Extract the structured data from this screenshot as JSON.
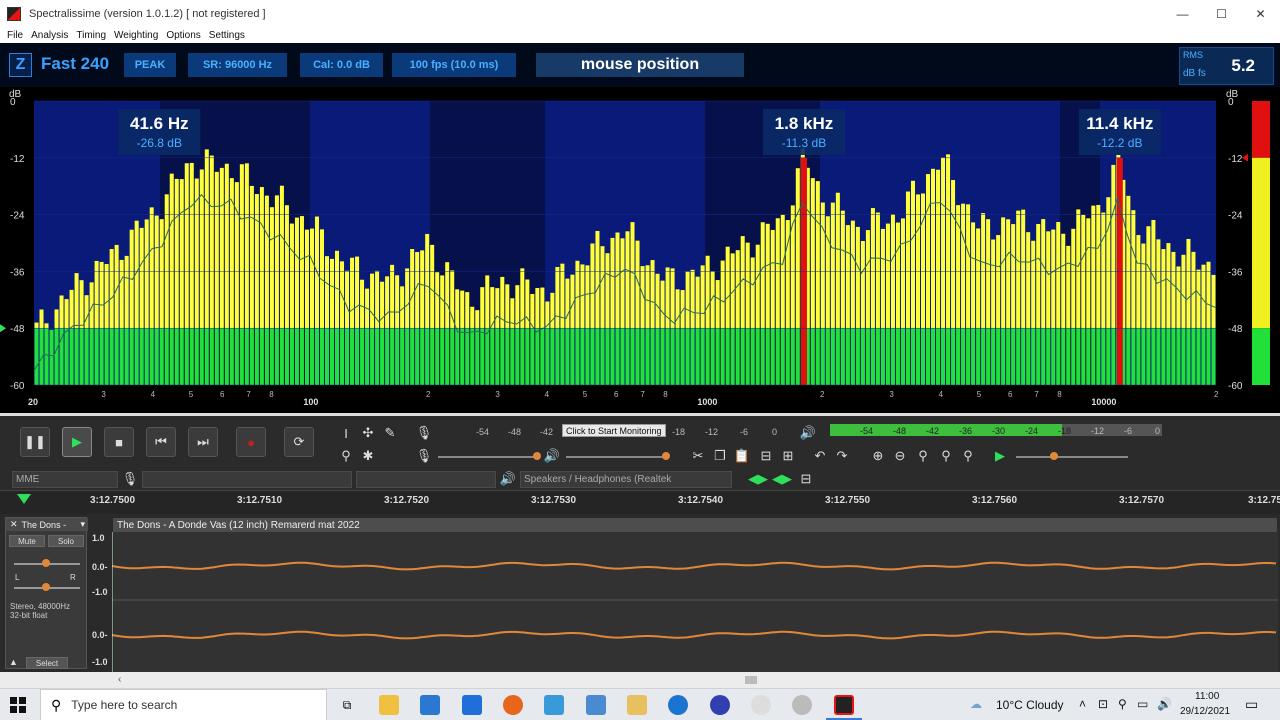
{
  "window": {
    "title": "Spectralissime (version 1.0.1.2) [ not registered ]",
    "controls": [
      "—",
      "☐",
      "✕"
    ]
  },
  "menu": [
    "File",
    "Analysis",
    "Timing",
    "Weighting",
    "Options",
    "Settings"
  ],
  "spectrum_header": {
    "z_label": "Z",
    "mode": "Fast 240",
    "peak": "PEAK",
    "sr": "SR: 96000 Hz",
    "cal": "Cal:  0.0 dB",
    "fps": "100 fps (10.0 ms)",
    "mouse_position": "mouse position",
    "rms_label": "RMS",
    "dbfs_label": "dB fs",
    "rms_value": "5.2"
  },
  "spectrum": {
    "db_unit": "dB",
    "db_ticks": [
      "0",
      "-12",
      "-24",
      "-36",
      "-48",
      "-60"
    ],
    "peaks": [
      {
        "freq": "41.6 Hz",
        "level": "-26.8 dB"
      },
      {
        "freq": "1.8 kHz",
        "level": "-11.3 dB"
      },
      {
        "freq": "11.4 kHz",
        "level": "-12.2 dB"
      }
    ],
    "freq_labels": [
      "20",
      "100",
      "1000",
      "10000"
    ],
    "minor_labels": [
      "3",
      "4",
      "5",
      "6",
      "7",
      "8",
      "2",
      "3",
      "4",
      "5",
      "6",
      "7",
      "8",
      "2",
      "3",
      "4",
      "5",
      "6",
      "7",
      "8",
      "2"
    ]
  },
  "chart_data": {
    "type": "bar",
    "title": "",
    "xlabel": "",
    "ylabel": "dB",
    "ylim": [
      -60,
      0
    ],
    "x_scale": "log",
    "xlim": [
      20,
      20000
    ],
    "x_ticks": [
      20,
      100,
      1000,
      10000
    ],
    "series": [
      {
        "name": "",
        "x": [
          20,
          25,
          31.5,
          40,
          50,
          63,
          80,
          100,
          125,
          160,
          200,
          250,
          315,
          400,
          500,
          630,
          800,
          1000,
          1250,
          1600,
          1800,
          2000,
          2500,
          3150,
          4000,
          5000,
          6300,
          8000,
          10000,
          11400,
          12500,
          16000,
          20000
        ],
        "values": [
          -49,
          -40,
          -33,
          -24,
          -13,
          -14,
          -20,
          -26,
          -35,
          -38,
          -30,
          -42,
          -38,
          -40,
          -33,
          -27,
          -38,
          -36,
          -31,
          -25,
          -12,
          -20,
          -27,
          -24,
          -12,
          -27,
          -25,
          -28,
          -23,
          -13,
          -26,
          -32,
          -35
        ]
      }
    ],
    "grid": false,
    "legend": "none"
  },
  "toolbar": {
    "pause": "❚❚",
    "play": "▶",
    "stop": "■",
    "skip_start": "⏮",
    "skip_end": "⏭",
    "record": "●",
    "loop": "⟳",
    "monitor": "Click to Start Monitoring",
    "rec_scale": [
      "-54",
      "-48",
      "-42",
      "-18",
      "-12",
      "-6",
      "0"
    ],
    "play_scale": [
      "-54",
      "-48",
      "-42",
      "-36",
      "-30",
      "-24",
      "-18",
      "-12",
      "-6",
      "0"
    ],
    "host": "MME",
    "output_device": "Speakers / Headphones (Realtek"
  },
  "timeline": {
    "labels": [
      "3:12.7500",
      "3:12.7510",
      "3:12.7520",
      "3:12.7530",
      "3:12.7540",
      "3:12.7550",
      "3:12.7560",
      "3:12.7570",
      "3:12.75"
    ]
  },
  "track": {
    "name": "The Dons -",
    "mute": "Mute",
    "solo": "Solo",
    "pan_l": "L",
    "pan_r": "R",
    "info1": "Stereo, 48000Hz",
    "info2": "32-bit float",
    "select": "Select",
    "clip_title": "The Dons - A Donde Vas (12 inch) Remarerd mat 2022",
    "amp_labels": [
      "1.0",
      "0.0-",
      "-1.0",
      "0.0-",
      "-1.0"
    ]
  },
  "taskbar": {
    "search_placeholder": "Type here to search",
    "weather": "10°C  Cloudy",
    "time": "11:00",
    "date": "29/12/2021"
  },
  "colors": {
    "bar_yellow": "#ffff3a",
    "bar_green": "#22e03a",
    "peak_red": "#e01010",
    "accent_blue": "#38a0ff",
    "waveform": "#e0883a"
  }
}
